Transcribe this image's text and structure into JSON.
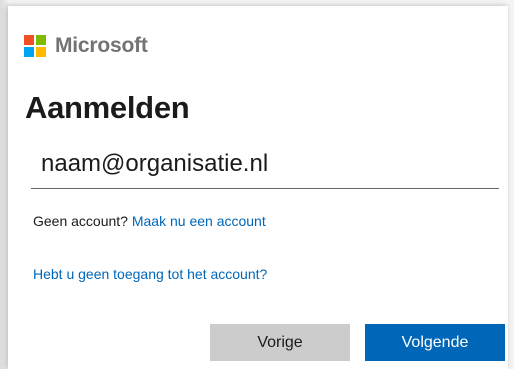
{
  "brand": {
    "name": "Microsoft",
    "logo_colors": [
      "#f25022",
      "#7fba00",
      "#00a4ef",
      "#ffb900"
    ]
  },
  "page": {
    "title": "Aanmelden"
  },
  "signin": {
    "email_value": "naam@organisatie.nl",
    "no_account_text": "Geen account?",
    "create_account_link": "Maak nu een account",
    "no_access_link": "Hebt u geen toegang tot het account?"
  },
  "buttons": {
    "back_label": "Vorige",
    "next_label": "Volgende"
  },
  "colors": {
    "accent": "#0067b8",
    "secondary_button": "#cccccc"
  }
}
